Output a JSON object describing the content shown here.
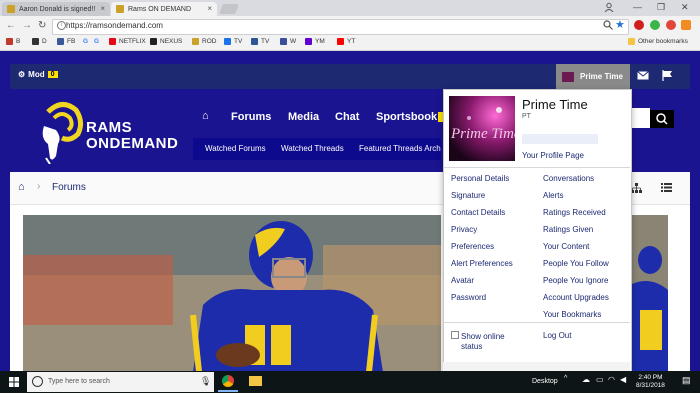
{
  "browser": {
    "tabs": [
      {
        "title": "Aaron Donald is signed!!"
      },
      {
        "title": "Rams ON DEMAND"
      }
    ],
    "url": "https://ramsondemand.com",
    "bookmarks": [
      "B",
      "D",
      "FB",
      "G",
      "G",
      "NETFLIX",
      "NEXUS",
      "ROD",
      "TV",
      "TV",
      "W",
      "YM",
      "YT"
    ],
    "other_bookmarks": "Other bookmarks"
  },
  "site": {
    "mod_label": "Mod",
    "mod_count": "0",
    "user_button": "Prime Time",
    "logo_line1": "RAMS",
    "logo_line2": "ONDEMAND",
    "nav": [
      "Forums",
      "Media",
      "Chat",
      "Sportsbook"
    ],
    "subnav": [
      "Watched Forums",
      "Watched Threads",
      "Featured Threads Arch"
    ],
    "breadcrumb": "Forums"
  },
  "dropdown": {
    "avatar_text": "Prime Time",
    "name": "Prime Time",
    "subtitle": "PT",
    "profile_link": "Your Profile Page",
    "left_links": [
      "Personal Details",
      "Signature",
      "Contact Details",
      "Privacy",
      "Preferences",
      "Alert Preferences",
      "Avatar",
      "Password"
    ],
    "right_links": [
      "Conversations",
      "Alerts",
      "Ratings Received",
      "Ratings Given",
      "Your Content",
      "People You Follow",
      "People You Ignore",
      "Account Upgrades",
      "Your Bookmarks"
    ],
    "show_online_line1": "Show online",
    "show_online_line2": "status",
    "logout": "Log Out"
  },
  "taskbar": {
    "search_placeholder": "Type here to search",
    "desktop_label": "Desktop",
    "time": "2:40 PM",
    "date": "8/31/2018"
  },
  "colors": {
    "site_bg": "#1b1491",
    "top_strip": "#1d2a72",
    "link": "#1d2a72",
    "badge": "#ffe100"
  }
}
